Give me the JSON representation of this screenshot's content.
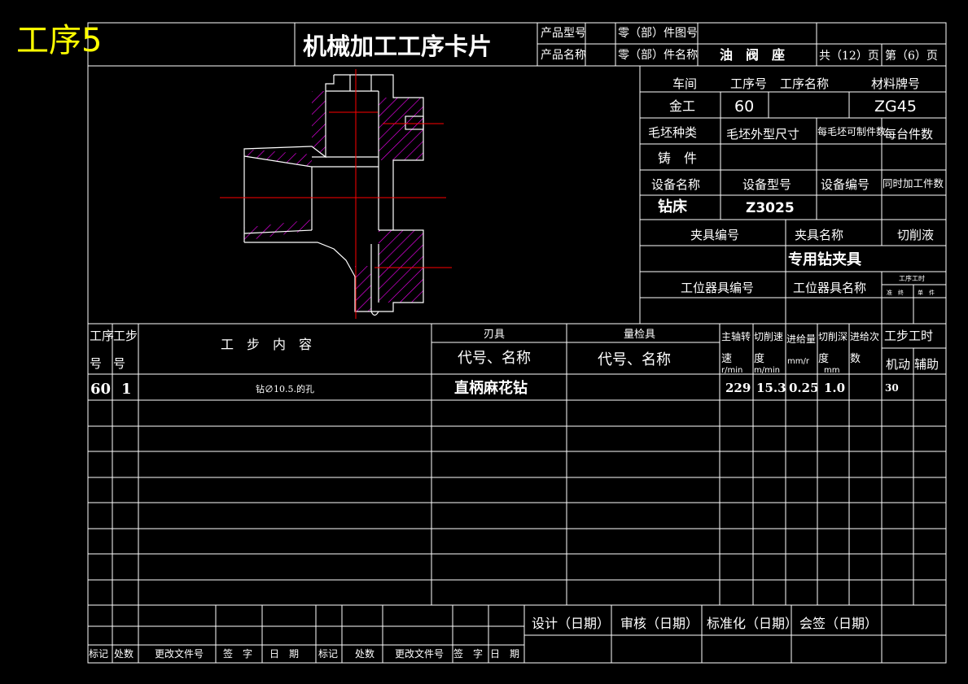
{
  "badge": "工序5",
  "title": "机械加工工序卡片",
  "header": {
    "product_model_label": "产品型号",
    "part_drawing_no_label": "零（部）件图号",
    "product_name_label": "产品名称",
    "part_name_label": "零（部）件名称",
    "part_name": "油　阀　座",
    "total_pages_text": "共（12）页",
    "page_no_text": "第（6）页"
  },
  "info": {
    "workshop_label": "车间",
    "op_no_label": "工序号",
    "op_name_label": "工序名称",
    "material_label": "材料牌号",
    "workshop": "金工",
    "op_no": "60",
    "op_name": "",
    "material": "ZG45",
    "blank_type_label": "毛坯种类",
    "blank_size_label": "毛坯外型尺寸",
    "parts_per_blank_label": "每毛坯可制件数",
    "per_unit_label": "每台件数",
    "blank_type": "铸　件",
    "equip_name_label": "设备名称",
    "equip_model_label": "设备型号",
    "equip_no_label": "设备编号",
    "simul_parts_label": "同时加工件数",
    "equip_name": "钻床",
    "equip_model": "Z3025",
    "fixture_no_label": "夹具编号",
    "fixture_name_label": "夹具名称",
    "coolant_label": "切削液",
    "fixture_name": "专用钻夹具",
    "station_tool_no_label": "工位器具编号",
    "station_tool_name_label": "工位器具名称",
    "op_time_label": "工序工时",
    "prep_label": "准　终",
    "unit_label": "单　件"
  },
  "steps_header": {
    "op_no_l1": "工序",
    "op_no_l2": "号",
    "step_no_l1": "工步",
    "step_no_l2": "号",
    "content": "工　步　内　容",
    "tool": "刃具",
    "tool_code": "代号、名称",
    "gauge": "量检具",
    "gauge_code": "代号、名称",
    "spindle_l1": "主轴转",
    "spindle_l2": "速",
    "spindle_unit": "r/min",
    "cut_speed_l1": "切削速",
    "cut_speed_l2": "度",
    "cut_speed_unit": "m/min",
    "feed_l1": "进给量",
    "feed_unit": "mm/r",
    "depth_l1": "切削深",
    "depth_l2": "度",
    "depth_unit": "mm",
    "passes_l1": "进给次",
    "passes_l2": "数",
    "step_time": "工步工时",
    "machine": "机动",
    "aux": "辅助"
  },
  "steps": [
    {
      "op_no": "60",
      "step_no": "1",
      "content": "钻∅10.5.的孔",
      "tool": "直柄麻花钻",
      "gauge": "",
      "spindle": "229",
      "cut_speed": "15.3",
      "feed": "0.25",
      "depth": "1.0",
      "passes": "",
      "machine_time": "30",
      "aux_time": ""
    }
  ],
  "footer": {
    "design": "设计（日期）",
    "review": "审核（日期）",
    "standard": "标准化（日期）",
    "countersign": "会签（日期）",
    "mark": "标记",
    "count": "处数",
    "change_doc": "更改文件号",
    "signature": "签　字",
    "date": "日　期",
    "mark2": "标记",
    "count2": "处数",
    "change_doc2": "更改文件号",
    "signature2": "签　字",
    "date2": "日　期"
  },
  "colors": {
    "line": "#ffffff",
    "badge": "#ffff00",
    "hatch": "#ff00ff",
    "centerline": "#ff0000"
  }
}
